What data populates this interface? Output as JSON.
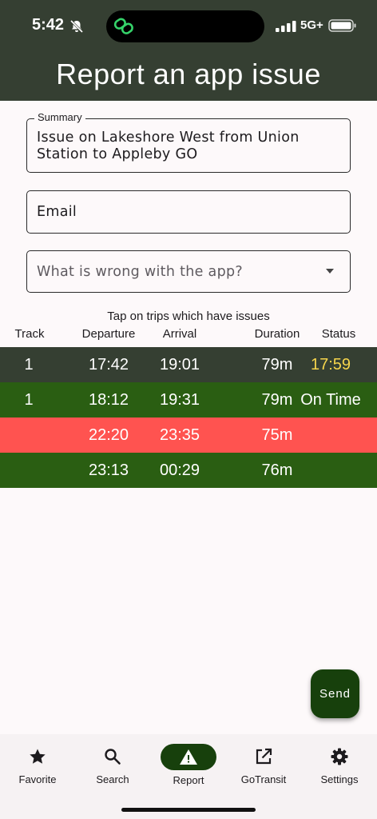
{
  "status_bar": {
    "time": "5:42",
    "network": "5G+"
  },
  "header": {
    "title": "Report an app issue"
  },
  "form": {
    "summary_label": "Summary",
    "summary_value": "Issue on Lakeshore West from Union Station to Appleby GO",
    "email_placeholder": "Email",
    "issue_select_placeholder": "What is wrong with the app?"
  },
  "trips": {
    "hint": "Tap on trips which have issues",
    "columns": [
      "Track",
      "Departure",
      "Arrival",
      "Duration",
      "Status"
    ],
    "rows": [
      {
        "track": "1",
        "departure": "17:42",
        "arrival": "19:01",
        "duration": "79m",
        "status": "17:59"
      },
      {
        "track": "1",
        "departure": "18:12",
        "arrival": "19:31",
        "duration": "79m",
        "status": "On Time"
      },
      {
        "track": "",
        "departure": "22:20",
        "arrival": "23:35",
        "duration": "75m",
        "status": ""
      },
      {
        "track": "",
        "departure": "23:13",
        "arrival": "00:29",
        "duration": "76m",
        "status": ""
      }
    ]
  },
  "send_button": {
    "label": "Send"
  },
  "nav": {
    "items": [
      {
        "label": "Favorite",
        "icon": "star-icon"
      },
      {
        "label": "Search",
        "icon": "search-icon"
      },
      {
        "label": "Report",
        "icon": "warning-icon",
        "active": true
      },
      {
        "label": "GoTransit",
        "icon": "open-external-icon"
      },
      {
        "label": "Settings",
        "icon": "gear-icon"
      }
    ]
  },
  "colors": {
    "header_bg": "#353f32",
    "on_time_row": "#2a5e12",
    "cancelled_row": "#ff5350",
    "delay_text": "#f6d54c",
    "accent": "#17400c"
  }
}
